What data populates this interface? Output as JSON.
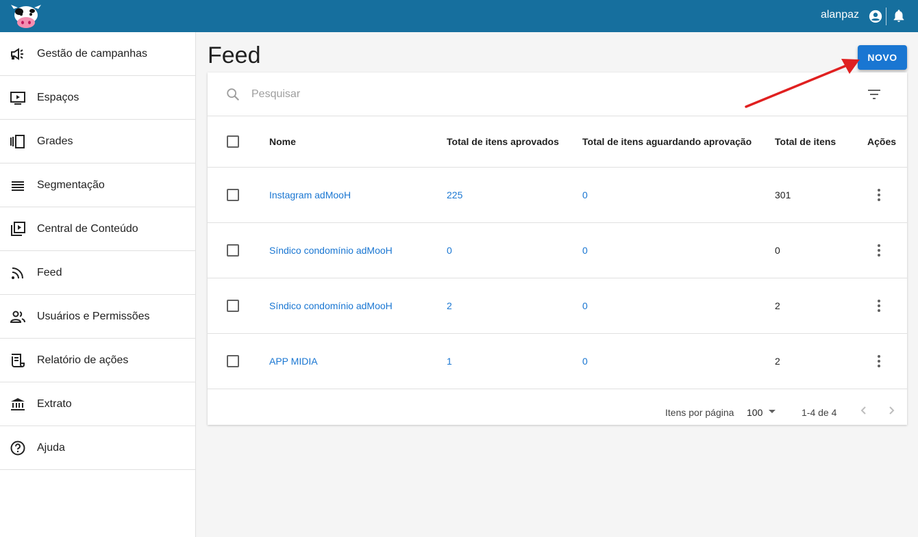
{
  "header": {
    "username": "alanpaz",
    "logo_icon": "cow-logo",
    "colors": {
      "bar": "#166f9e",
      "text": "#ffffff"
    }
  },
  "sidebar": {
    "items": [
      {
        "label": "Gestão de campanhas",
        "icon": "megaphone-icon"
      },
      {
        "label": "Espaços",
        "icon": "screen-play-icon"
      },
      {
        "label": "Grades",
        "icon": "carousel-icon"
      },
      {
        "label": "Segmentação",
        "icon": "list-lines-icon"
      },
      {
        "label": "Central de Conteúdo",
        "icon": "video-library-icon"
      },
      {
        "label": "Feed",
        "icon": "rss-icon"
      },
      {
        "label": "Usuários e Permissões",
        "icon": "people-icon"
      },
      {
        "label": "Relatório de ações",
        "icon": "scroll-icon"
      },
      {
        "label": "Extrato",
        "icon": "bank-icon"
      },
      {
        "label": "Ajuda",
        "icon": "help-icon"
      }
    ]
  },
  "main": {
    "title": "Feed",
    "new_button_label": "NOVO",
    "accent_color": "#1976d2",
    "search": {
      "placeholder": "Pesquisar",
      "value": ""
    },
    "table": {
      "columns": [
        "Nome",
        "Total de itens aprovados",
        "Total de itens aguardando aprovação",
        "Total de itens",
        "Ações"
      ],
      "rows": [
        {
          "nome": "Instagram adMooH",
          "aprovados": "225",
          "aguardando": "0",
          "total": "301"
        },
        {
          "nome": "Síndico condomínio adMooH",
          "aprovados": "0",
          "aguardando": "0",
          "total": "0"
        },
        {
          "nome": "Síndico condomínio adMooH",
          "aprovados": "2",
          "aguardando": "0",
          "total": "2"
        },
        {
          "nome": "APP MIDIA",
          "aprovados": "1",
          "aguardando": "0",
          "total": "2"
        }
      ]
    },
    "pagination": {
      "per_page_label": "Itens por página",
      "per_page_value": "100",
      "range": "1-4 de 4"
    }
  }
}
